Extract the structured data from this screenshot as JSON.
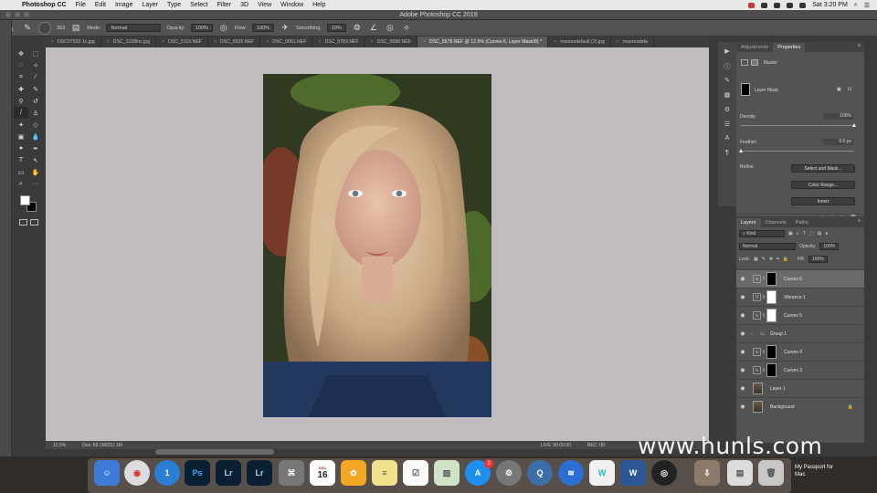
{
  "menubar": {
    "app_name": "Photoshop CC",
    "items": [
      "File",
      "Edit",
      "Image",
      "Layer",
      "Type",
      "Select",
      "Filter",
      "3D",
      "View",
      "Window",
      "Help"
    ],
    "clock": "Sat 3:20 PM"
  },
  "titlebar": {
    "title": "Adobe Photoshop CC 2019"
  },
  "options": {
    "brush_size": "353",
    "mode_label": "Mode:",
    "mode_value": "Normal",
    "opacity_label": "Opacity:",
    "opacity_value": "100%",
    "flow_label": "Flow:",
    "flow_value": "100%",
    "smoothing_label": "Smoothing:",
    "smoothing_value": "10%"
  },
  "tabs": [
    {
      "label": "DSC07502 1c.jpg"
    },
    {
      "label": "DSC_3158lnc.jpg"
    },
    {
      "label": "DSC_5115.NEF"
    },
    {
      "label": "DSC_6525.NEF"
    },
    {
      "label": "DSC_0061.NEF"
    },
    {
      "label": "DSC_5783.NEF"
    },
    {
      "label": "DSC_0088.NEF"
    },
    {
      "label": "DSC_6578.NEF @ 12.5% (Curves 6, Layer Mask/8) *"
    },
    {
      "label": "maxresdefault (2).jpg"
    },
    {
      "label": "maxresdefa"
    }
  ],
  "status": {
    "zoom": "12.5%",
    "doc": "Doc: 69.1M/231.1M",
    "live": "LIVE: 00:00:00",
    "rec": "REC: 00:"
  },
  "properties": {
    "tab_adjustments": "Adjustments",
    "tab_properties": "Properties",
    "masks_label": "Masks",
    "layer_mask_label": "Layer Mask",
    "density_label": "Density:",
    "density_value": "100%",
    "density_level": 1.0,
    "feather_label": "Feather:",
    "feather_value": "0.0 px",
    "feather_level": 0.0,
    "refine_label": "Refine:",
    "select_and_mask": "Select and Mask...",
    "color_range": "Color Range...",
    "invert": "Invert"
  },
  "layers_panel": {
    "tab_layers": "Layers",
    "tab_channels": "Channels",
    "tab_paths": "Paths",
    "kind_label": "Kind",
    "blend_mode": "Normal",
    "opacity_label": "Opacity:",
    "opacity_value": "100%",
    "lock_label": "Lock:",
    "fill_label": "Fill:",
    "fill_value": "100%",
    "layers": [
      {
        "name": "Curves 6",
        "mask": "b",
        "adj": "curves",
        "selected": true
      },
      {
        "name": "Vibrance 1",
        "mask": "w",
        "adj": "vibrance",
        "selected": false
      },
      {
        "name": "Curves 5",
        "mask": "w",
        "adj": "curves",
        "selected": false
      },
      {
        "name": "Group 1",
        "mask": "",
        "adj": "group",
        "selected": false
      },
      {
        "name": "Curves 4",
        "mask": "b",
        "adj": "curves",
        "selected": false
      },
      {
        "name": "Curves 3",
        "mask": "b",
        "adj": "curves",
        "selected": false
      },
      {
        "name": "Layer 1",
        "mask": "",
        "adj": "pixel",
        "selected": false
      },
      {
        "name": "Background",
        "mask": "",
        "adj": "pixel",
        "selected": false
      }
    ]
  },
  "dock": {
    "passport_label": "My Passport for Mac",
    "calendar_day": "16",
    "calendar_month": "DEC",
    "appstore_badge": "2"
  },
  "watermark": "www.hunls.com",
  "colors": {
    "canvas_bg": "#c0bcc0",
    "panel_bg": "#535353",
    "selected_layer": "#6a6a6a"
  }
}
